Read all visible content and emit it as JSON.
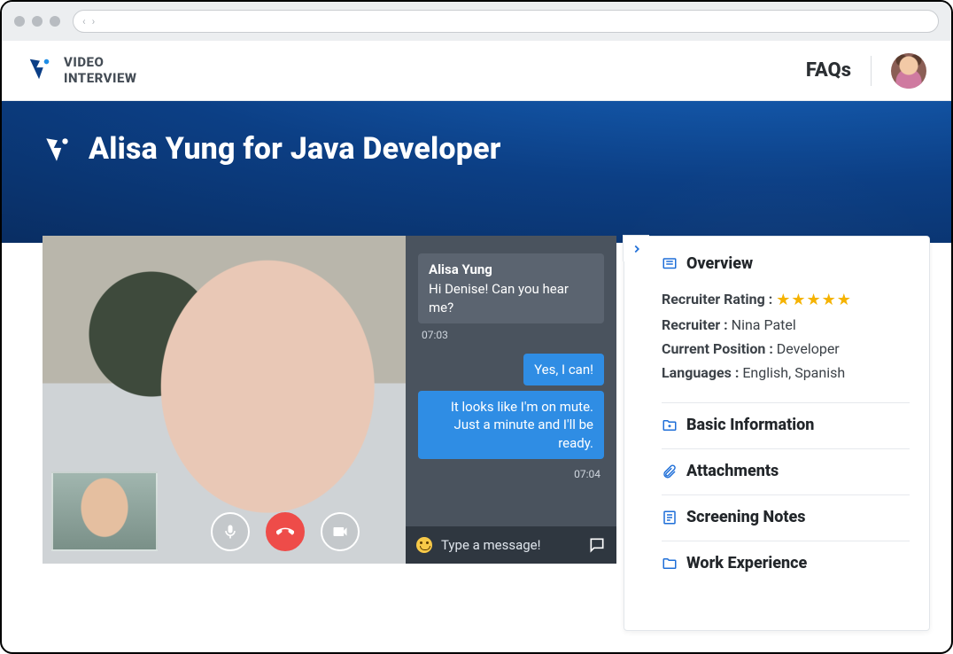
{
  "brand": {
    "line1": "VIDEO",
    "line2": "INTERVIEW"
  },
  "header": {
    "faqs": "FAQs"
  },
  "hero": {
    "title": "Alisa Yung for Java Developer"
  },
  "chat": {
    "sender_name": "Alisa Yung",
    "msg1": "Hi Denise! Can you hear me?",
    "time1": "07:03",
    "msg2": "Yes, I can!",
    "msg3": "It looks like I'm on mute. Just a minute and I'll be ready.",
    "time2": "07:04",
    "placeholder": "Type a message!"
  },
  "side": {
    "overview_label": "Overview",
    "rating_label": "Recruiter Rating :",
    "rating_stars": "★★★★★",
    "recruiter_label": "Recruiter :",
    "recruiter_value": "Nina Patel",
    "position_label": "Current Position :",
    "position_value": "Developer",
    "languages_label": "Languages :",
    "languages_value": "English, Spanish",
    "basic_info": "Basic Information",
    "attachments": "Attachments",
    "screening_notes": "Screening Notes",
    "work_experience": "Work Experience"
  }
}
